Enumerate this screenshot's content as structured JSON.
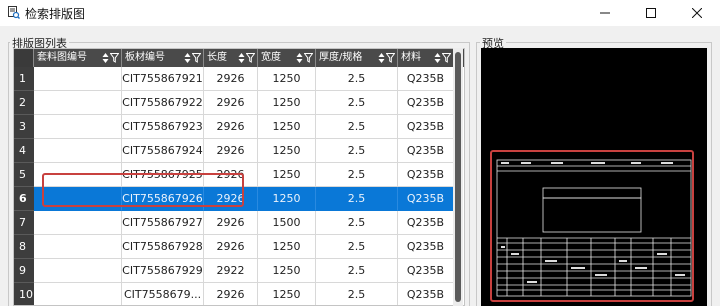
{
  "window": {
    "title": "检索排版图"
  },
  "groups": {
    "list_label": "排版图列表",
    "preview_label": "预览"
  },
  "grid": {
    "columns": [
      "套料图编号",
      "板材编号",
      "长度",
      "宽度",
      "厚度/规格",
      "材料"
    ],
    "rows": [
      {
        "no": "1",
        "nest": "",
        "plate": "CIT755867921",
        "length": "2926",
        "width": "1250",
        "thickness": "2.5",
        "material": "Q235B"
      },
      {
        "no": "2",
        "nest": "",
        "plate": "CIT755867922",
        "length": "2926",
        "width": "1250",
        "thickness": "2.5",
        "material": "Q235B"
      },
      {
        "no": "3",
        "nest": "",
        "plate": "CIT755867923",
        "length": "2926",
        "width": "1250",
        "thickness": "2.5",
        "material": "Q235B"
      },
      {
        "no": "4",
        "nest": "",
        "plate": "CIT755867924",
        "length": "2926",
        "width": "1250",
        "thickness": "2.5",
        "material": "Q235B"
      },
      {
        "no": "5",
        "nest": "",
        "plate": "CIT755867925",
        "length": "2926",
        "width": "1250",
        "thickness": "2.5",
        "material": "Q235B"
      },
      {
        "no": "6",
        "nest": "",
        "plate": "CIT755867926",
        "length": "2926",
        "width": "1250",
        "thickness": "2.5",
        "material": "Q235B",
        "selected": true
      },
      {
        "no": "7",
        "nest": "",
        "plate": "CIT755867927",
        "length": "2926",
        "width": "1500",
        "thickness": "2.5",
        "material": "Q235B"
      },
      {
        "no": "8",
        "nest": "",
        "plate": "CIT755867928",
        "length": "2926",
        "width": "1250",
        "thickness": "2.5",
        "material": "Q235B"
      },
      {
        "no": "9",
        "nest": "",
        "plate": "CIT755867929",
        "length": "2922",
        "width": "1250",
        "thickness": "2.5",
        "material": "Q235B"
      },
      {
        "no": "10",
        "nest": "",
        "plate": "CIT7558679...",
        "length": "2926",
        "width": "1250",
        "thickness": "2.5",
        "material": "Q235B"
      }
    ]
  },
  "colors": {
    "header_bg": "#4a4a4a",
    "selection": "#0a78d7",
    "annotation": "#c8413f",
    "preview_bg": "#000000"
  },
  "icons": [
    "app-icon",
    "minimize-icon",
    "maximize-icon",
    "close-icon",
    "sort-icon",
    "filter-icon"
  ]
}
